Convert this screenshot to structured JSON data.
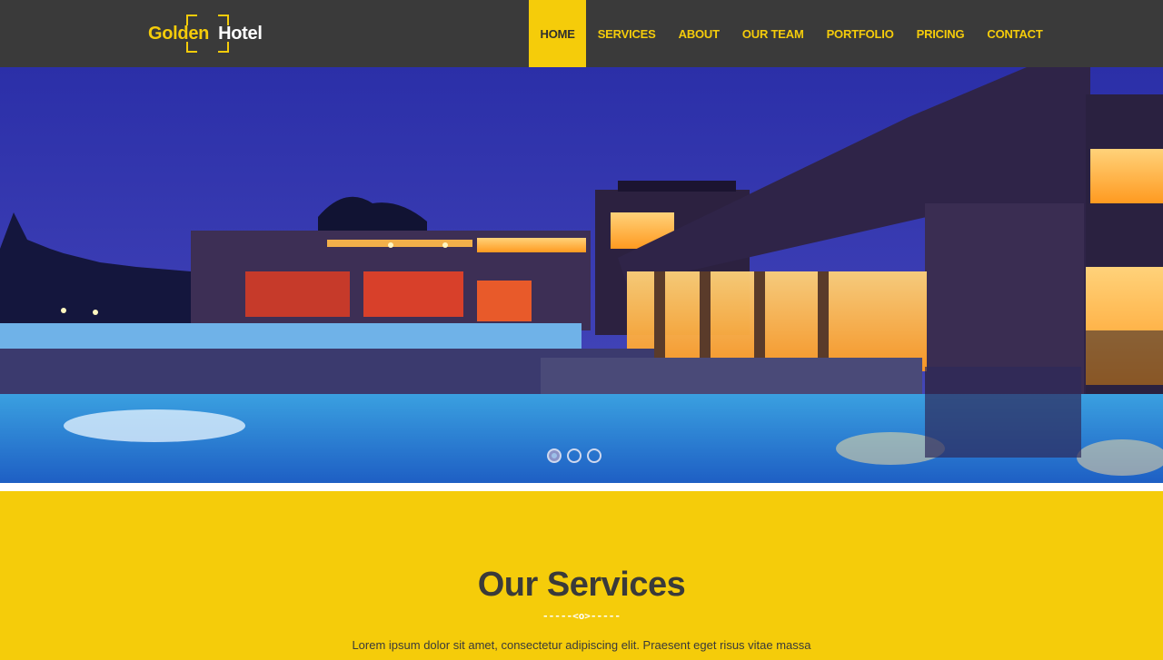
{
  "brand": {
    "word1": "Golden",
    "word2": "Hotel"
  },
  "nav": {
    "items": [
      {
        "label": "HOME",
        "active": true
      },
      {
        "label": "SERVICES"
      },
      {
        "label": "ABOUT"
      },
      {
        "label": "OUR TEAM"
      },
      {
        "label": "PORTFOLIO"
      },
      {
        "label": "PRICING"
      },
      {
        "label": "CONTACT"
      }
    ]
  },
  "slider": {
    "slides": 3,
    "active_index": 0
  },
  "services": {
    "title": "Our Services",
    "divider": "-----<o>-----",
    "lead": "Lorem ipsum dolor sit amet, consectetur adipiscing elit. Praesent eget risus vitae massa"
  },
  "colors": {
    "accent": "#f5cc0a",
    "topbar": "#3a3a3a",
    "text": "#3a3a3a"
  }
}
